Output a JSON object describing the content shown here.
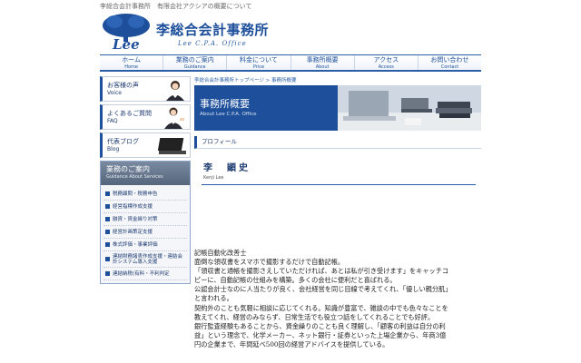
{
  "topbar": {
    "text": "李総合会計事務所　有限会社アクシアの概要について"
  },
  "brand": {
    "logo_text": "Lee",
    "title": "李総合会計事務所",
    "subtitle": "Lee C.P.A. Office",
    "accent": "#1d4f9a"
  },
  "nav": [
    {
      "jp": "ホーム",
      "en": "Home"
    },
    {
      "jp": "業務のご案内",
      "en": "Guidance"
    },
    {
      "jp": "料金について",
      "en": "Price"
    },
    {
      "jp": "事務所概要",
      "en": "About"
    },
    {
      "jp": "アクセス",
      "en": "Access"
    },
    {
      "jp": "お問い合わせ",
      "en": "Contact"
    }
  ],
  "sidebar": {
    "cards": [
      {
        "jp": "お客様の声",
        "en": "Voice"
      },
      {
        "jp": "よくあるご質問",
        "en": "FAQ"
      },
      {
        "jp": "代表ブログ",
        "en": "Blog"
      }
    ],
    "guide": {
      "title": "業務のご案内",
      "subtitle": "Guidance About Services",
      "items": [
        "税務顧問・税務申告",
        "経営指標作成支援",
        "融資・資金繰り対策",
        "経営計画策定支援",
        "株式評価・事業評価",
        "連結財務諸表作成支援・連結会計システム導入支援",
        "連結納税(有料・不利判定"
      ]
    }
  },
  "main": {
    "breadcrumb": "李総合会計事務所トップページ > 事務所概要",
    "banner_title": "事務所概要",
    "banner_sub": "About Lee C.P.A. Office",
    "section": "プロフィール",
    "name": "李　顕史",
    "name_en": "Kenji Lee",
    "body": [
      "記帳自動化改善士",
      "面倒な領収書をスマホで撮影するだけで自動記帳。",
      "「領収書と通帳を撮影さえしていただければ、あとは私が引き受けます」をキャッチコ",
      "ピーに、自動記帳の仕組みを構築。多くの会社に便利だと喜ばれる。",
      "公認会計士なのに人当たりが良く、会社経営を同じ目線で考えてくれ、「優しい親分肌」",
      "と言われる。",
      "契約外のことも気軽に相談に応じてくれる。知識が豊富で、雑談の中でも色々なことを",
      "教えてくれ、経営のみならず、日常生活でも役立つ話をしてくれることでも好評。",
      "銀行監査経験もあることから、資金繰りのことも良く理解し、「顧客の利益は自分の利",
      "益」という理念で、化学メーカー、ネット銀行・証券といった上場企業から、年商3億",
      "円の企業まで、年間延べ500回の経営アドバイスを提供している。"
    ]
  }
}
